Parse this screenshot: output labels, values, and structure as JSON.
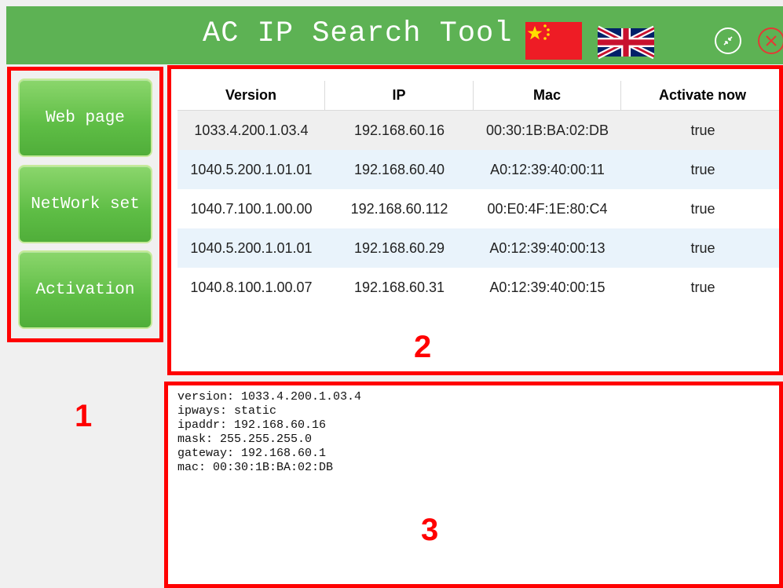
{
  "window": {
    "title": "AC IP Search Tool",
    "flags": [
      "china-flag-icon",
      "uk-flag-icon"
    ],
    "controls": [
      "shrink-icon",
      "close-icon"
    ]
  },
  "menu": {
    "web_page": "Web page",
    "network_set": "NetWork set",
    "activation": "Activation"
  },
  "table": {
    "headers": [
      "Version",
      "IP",
      "Mac",
      "Activate now"
    ],
    "rows": [
      [
        "1033.4.200.1.03.4",
        "192.168.60.16",
        "00:30:1B:BA:02:DB",
        "true"
      ],
      [
        "1040.5.200.1.01.01",
        "192.168.60.40",
        "A0:12:39:40:00:11",
        "true"
      ],
      [
        "1040.7.100.1.00.00",
        "192.168.60.112",
        "00:E0:4F:1E:80:C4",
        "true"
      ],
      [
        "1040.5.200.1.01.01",
        "192.168.60.29",
        "A0:12:39:40:00:13",
        "true"
      ],
      [
        "1040.8.100.1.00.07",
        "192.168.60.31",
        "A0:12:39:40:00:15",
        "true"
      ]
    ]
  },
  "details": {
    "lines": [
      "version: 1033.4.200.1.03.4",
      "ipways: static",
      "ipaddr: 192.168.60.16",
      "mask: 255.255.255.0",
      "gateway: 192.168.60.1",
      "mac: 00:30:1B:BA:02:DB"
    ]
  },
  "annotations": {
    "one": "1",
    "two": "2",
    "three": "3"
  },
  "colors": {
    "titlebar": "#5db254",
    "button_green": "#5ebd45",
    "annotation_red": "#ff0000",
    "row_alt": "#e9f3fb",
    "row_selected": "#efefef"
  }
}
